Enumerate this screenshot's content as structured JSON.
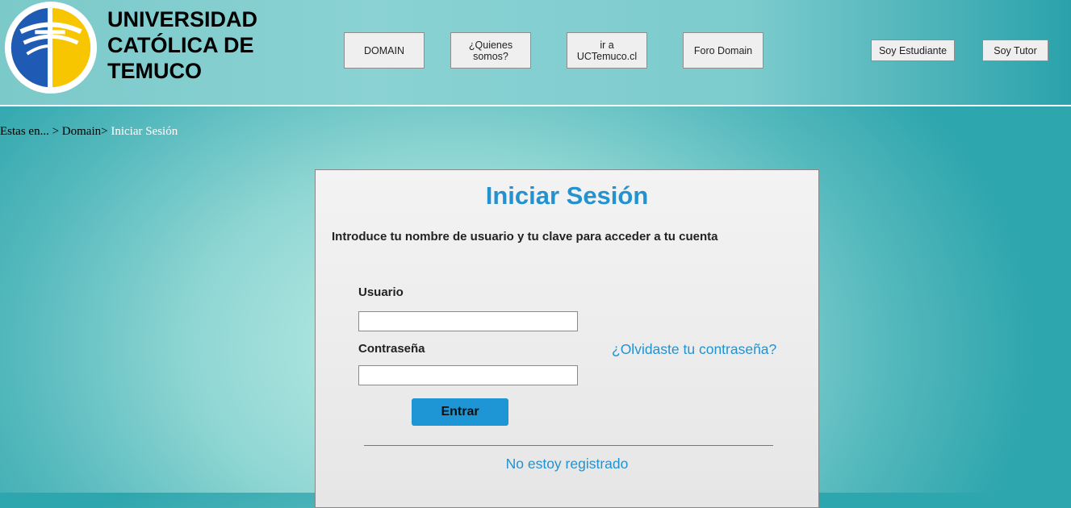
{
  "header": {
    "university_name": "UNIVERSIDAD\nCATÓLICA DE\nTEMUCO",
    "logo_icon": "university-cross-logo-icon",
    "colors": {
      "logo_blue": "#1f5bb5",
      "logo_yellow": "#f7c600"
    },
    "nav": [
      {
        "label": "DOMAIN"
      },
      {
        "label": "¿Quienes somos?"
      },
      {
        "label": "ir a UCTemuco.cl"
      },
      {
        "label": "Foro Domain"
      }
    ],
    "roles": {
      "student_label": "Soy Estudiante",
      "tutor_label": "Soy Tutor"
    }
  },
  "breadcrumb": {
    "prefix": "Estas en... > Domain>",
    "current": "Iniciar Sesión"
  },
  "login": {
    "title": "Iniciar Sesión",
    "intro": "Introduce tu nombre de usuario y tu clave para acceder a tu cuenta",
    "username_label": "Usuario",
    "username_value": "",
    "password_label": "Contraseña",
    "password_value": "",
    "forgot_link": "¿Olvidaste tu contraseña?",
    "submit_label": "Entrar",
    "register_link": "No estoy registrado",
    "accent_color": "#2392cf"
  }
}
